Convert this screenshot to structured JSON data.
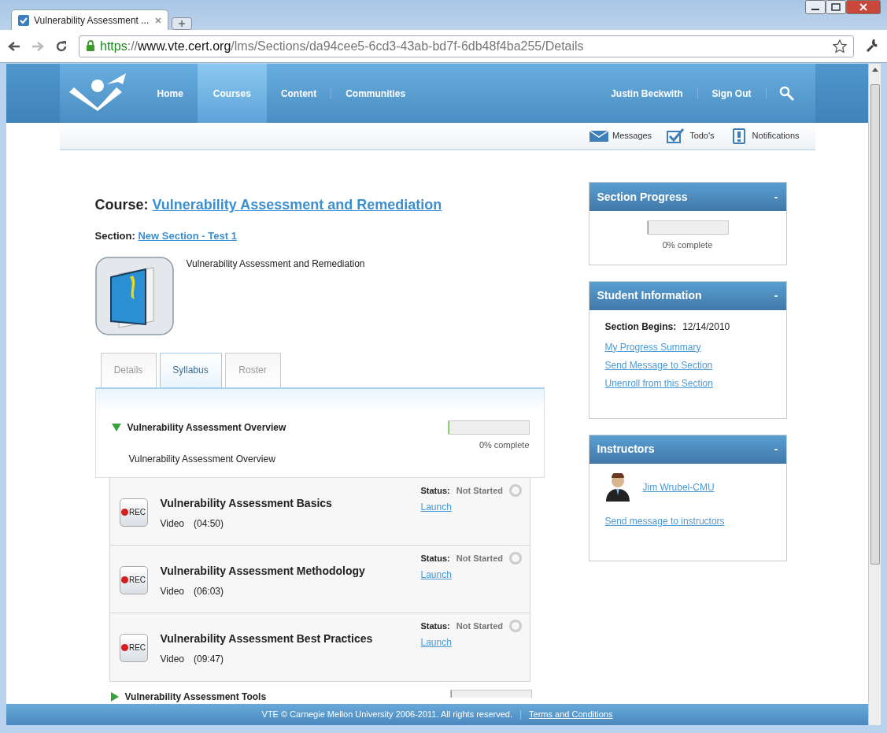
{
  "browser": {
    "tab_title": "Vulnerability Assessment ...",
    "url": {
      "scheme": "https",
      "sep": "://",
      "host": "www.vte.cert.org",
      "path": "/lms/Sections/da94cee5-6cd3-43ab-bd7f-6db48f4ba255/Details"
    }
  },
  "nav": {
    "items": [
      {
        "label": "Home",
        "selected": false
      },
      {
        "label": "Courses",
        "selected": true
      },
      {
        "label": "Content",
        "selected": false
      },
      {
        "label": "Communities",
        "selected": false
      }
    ],
    "user": "Justin Beckwith",
    "sign_out": "Sign Out"
  },
  "subbar": [
    {
      "kind": "mail",
      "label": "Messages"
    },
    {
      "kind": "todo",
      "label": "Todo's"
    },
    {
      "kind": "alert",
      "label": "Notifications"
    }
  ],
  "course": {
    "label": "Course:",
    "title": "Vulnerability Assessment and Remediation",
    "section_label": "Section:",
    "section": "New Section - Test 1",
    "description": "Vulnerability Assessment and Remediation"
  },
  "tabs": [
    {
      "label": "Details",
      "selected": false
    },
    {
      "label": "Syllabus",
      "selected": true
    },
    {
      "label": "Roster",
      "selected": false
    }
  ],
  "modules": [
    {
      "title": "Vulnerability Assessment Overview",
      "expanded": true,
      "description": "Vulnerability Assessment Overview",
      "progress": {
        "level": 0,
        "reading": "0% complete"
      },
      "lessons": [
        {
          "icon_text": "REC",
          "title": "Vulnerability Assessment Basics",
          "type": "Video",
          "duration": "(04:50)",
          "status_label": "Status:",
          "status": "Not Started",
          "action": "Launch"
        },
        {
          "icon_text": "REC",
          "title": "Vulnerability Assessment Methodology",
          "type": "Video",
          "duration": "(06:03)",
          "status_label": "Status:",
          "status": "Not Started",
          "action": "Launch"
        },
        {
          "icon_text": "REC",
          "title": "Vulnerability Assessment Best Practices",
          "type": "Video",
          "duration": "(09:47)",
          "status_label": "Status:",
          "status": "Not Started",
          "action": "Launch"
        }
      ]
    },
    {
      "title": "Vulnerability Assessment Tools",
      "expanded": false,
      "progress": {
        "level": 0
      }
    }
  ],
  "panels": [
    {
      "kind": "progress",
      "title": "Section Progress",
      "toggle": "-",
      "progress": {
        "level": 0,
        "reading": "0% complete"
      }
    },
    {
      "kind": "info",
      "title": "Student Information",
      "toggle": "-",
      "begins_label": "Section Begins:",
      "begins": "12/14/2010",
      "links": [
        "My Progress Summary",
        "Send Message to Section",
        "Unenroll from this Section"
      ]
    },
    {
      "kind": "instructors",
      "title": "Instructors",
      "toggle": "-",
      "instructors": [
        "Jim Wrubel-CMU"
      ],
      "link": "Send message to instructors"
    }
  ],
  "footer": {
    "text": "VTE © Carnegie Mellon University 2006-2011. All rights reserved.",
    "link": "Terms and Conditions"
  }
}
